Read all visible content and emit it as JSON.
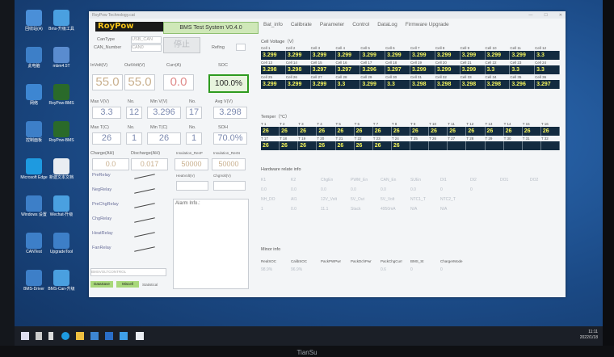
{
  "desktop": {
    "icons": [
      {
        "label": "回收站(A)",
        "color": "#4a8fd8"
      },
      {
        "label": "Bms-升级工具",
        "color": "#4aa0e0"
      },
      {
        "label": "此电脑",
        "color": "#3d7fc8"
      },
      {
        "label": "mbm4.5T",
        "color": "#5a8ccf"
      },
      {
        "label": "网络",
        "color": "#3d86d2"
      },
      {
        "label": "RoyPow-BMS",
        "color": "#2a6a2a"
      },
      {
        "label": "控制面板",
        "color": "#3d7fc8"
      },
      {
        "label": "RoyPow-BMS",
        "color": "#2a6a2a"
      },
      {
        "label": "Microsoft Edge",
        "color": "#1e9ae0"
      },
      {
        "label": "新建文本文档",
        "color": "#e9edf2"
      },
      {
        "label": "Windows 设置",
        "color": "#3d7fc8"
      },
      {
        "label": "Wechat-升级",
        "color": "#4aa0e0"
      },
      {
        "label": "CANTest",
        "color": "#3d7fc8"
      },
      {
        "label": "UpgradeTool",
        "color": "#3d7fc8"
      },
      {
        "label": "BMS-Driver",
        "color": "#3d7fc8"
      },
      {
        "label": "BMS-Can-升级",
        "color": "#4aa0e0"
      }
    ]
  },
  "window": {
    "title": "RoyPow Technology.cat",
    "logo": "RoyPow",
    "app_name": "BMS Test System V0.4.0",
    "can_type_label": "CanType",
    "can_type_value": "USB_CAN",
    "can_number_label": "CAN_Number",
    "can_number_value": "CAN0",
    "stop_button": "停止",
    "refresh_label": "Refing",
    "metrics": {
      "involt_label": "InVolt(V)",
      "involt": "55.0",
      "outvolt_label": "OutVolt(V)",
      "outvolt": "55.0",
      "curr_label": "Curr(A)",
      "curr": "0.0",
      "soc_label": "SOC",
      "soc": "100.0%",
      "maxv_label": "Max V(V)",
      "maxv": "3.3",
      "no1_label": "No.",
      "no1": "12",
      "minv_label": "Min V(V)",
      "minv": "3.296",
      "no2_label": "No.",
      "no2": "17",
      "avgv_label": "Avg V(V)",
      "avgv": "3.298",
      "maxt_label": "Max T(C)",
      "maxt": "26",
      "no3_label": "No.",
      "no3": "1",
      "mint_label": "Min T(C)",
      "mint": "26",
      "no4_label": "No.",
      "no4": "1",
      "soh_label": "SOH",
      "soh": "70.0%",
      "charge_label": "Charge(AH)",
      "charge": "0.0",
      "discharge_label": "Discharge(AH)",
      "discharge": "0.017",
      "insres_label": "Insulation_ResP",
      "insres": "50000",
      "insresn_label": "Insulation_ResN",
      "insresn": "50000",
      "heatvolt_label": "HeatVolt(V)",
      "chgvolt_label": "ChgVolt(V)"
    },
    "relays": [
      "PreRelay",
      "NegRelay",
      "PreChgRelay",
      "ChgRelay",
      "HeatRelay",
      "FanRelay"
    ],
    "alarm_label": "Alarm Info.:",
    "bottom_field": "BMSVOLTCONTROL",
    "bottom_btn1": "DataSave",
    "bottom_btn2": "Miscell",
    "bottom_label": "Statistical",
    "tabs": [
      "Bat_info",
      "Calibrate",
      "Parameter",
      "Control",
      "DataLog",
      "Firmware Upgrade"
    ],
    "cell_voltage_title": "Cell Voltage（V）",
    "cell_rows": [
      {
        "headers": [
          "Cell 1",
          "Cell 2",
          "Cell 3",
          "Cell 4",
          "Cell 5",
          "Cell 6",
          "Cell 7",
          "Cell 8",
          "Cell 9",
          "Cell 10",
          "Cell 11",
          "Cell 12"
        ],
        "values": [
          "3.299",
          "3.299",
          "3.299",
          "3.299",
          "3.299",
          "3.299",
          "3.299",
          "3.299",
          "3.299",
          "3.299",
          "3.299",
          "3.3"
        ]
      },
      {
        "headers": [
          "Cell 13",
          "Cell 14",
          "Cell 15",
          "Cell 16",
          "Cell 17",
          "Cell 18",
          "Cell 19",
          "Cell 20",
          "Cell 21",
          "Cell 22",
          "Cell 23",
          "Cell 24"
        ],
        "values": [
          "3.298",
          "3.298",
          "3.297",
          "3.297",
          "3.296",
          "3.297",
          "3.299",
          "3.299",
          "3.299",
          "3.3",
          "3.3",
          "3.3"
        ]
      },
      {
        "headers": [
          "Cell 25",
          "Cell 26",
          "Cell 27",
          "Cell 28",
          "Cell 29",
          "Cell 30",
          "Cell 31",
          "Cell 32",
          "Cell 33",
          "Cell 34",
          "Cell 35",
          "Cell 36"
        ],
        "values": [
          "3.299",
          "3.299",
          "3.299",
          "3.3",
          "3.299",
          "3.3",
          "3.298",
          "3.298",
          "3.298",
          "3.298",
          "3.296",
          "3.297"
        ]
      }
    ],
    "temp_title": "Temper（°C）",
    "temp_rows": [
      {
        "headers": [
          "T 1",
          "T 2",
          "T 3",
          "T 4",
          "T 5",
          "T 6",
          "T 7",
          "T 8",
          "T 9",
          "T 10",
          "T 11",
          "T 12",
          "T 13",
          "T 14",
          "T 15",
          "T 16"
        ],
        "values": [
          "26",
          "26",
          "26",
          "26",
          "26",
          "26",
          "26",
          "26",
          "26",
          "26",
          "26",
          "26",
          "26",
          "26",
          "26",
          "26"
        ]
      },
      {
        "headers": [
          "T 17",
          "T 18",
          "T 19",
          "T 20",
          "T 21",
          "T 22",
          "T 23",
          "T 24",
          "T 25",
          "T 26",
          "T 27",
          "T 28",
          "T 29",
          "T 30",
          "T 31",
          "T 32"
        ],
        "values": [
          "26",
          "26",
          "26",
          "26",
          "26",
          "26",
          "26",
          "26",
          "",
          "",
          "",
          "",
          "",
          "",
          "",
          ""
        ]
      }
    ],
    "hw_title": "Hardware relate info",
    "hw_rows": [
      [
        "K1",
        "K2",
        "ChgEn",
        "PWM_En",
        "CAN_En",
        "SUEn",
        "DI1",
        "DI2",
        "DO1",
        "DO2"
      ],
      [
        "0.0",
        "0.0",
        "0.0",
        "0.0",
        "0.0",
        "0.0",
        "0",
        "0",
        "",
        ""
      ],
      [
        "NH_DO",
        "AI1",
        "12V_Volt",
        "5V_Out",
        "5V_Volt",
        "NTC1_T",
        "NTC2_T",
        "",
        "",
        ""
      ],
      [
        "1",
        "0.0",
        "11.1",
        "Stack",
        "4950mA",
        "N/A",
        "N/A",
        "",
        "",
        ""
      ]
    ],
    "minor_title": "Minor info",
    "minor_headers": [
      "RealSOC",
      "CalibSOC",
      "PackPWPwr",
      "PackDchPwr",
      "PackChgCurr",
      "BMS_St",
      "ChargerMode"
    ],
    "minor_values": [
      "98.9%",
      "96.9%",
      "",
      "",
      "0.6",
      "0",
      "0"
    ]
  },
  "taskbar": {
    "time": "11:11",
    "date": "2022/1/18"
  },
  "monitor_brand": "TianSu"
}
